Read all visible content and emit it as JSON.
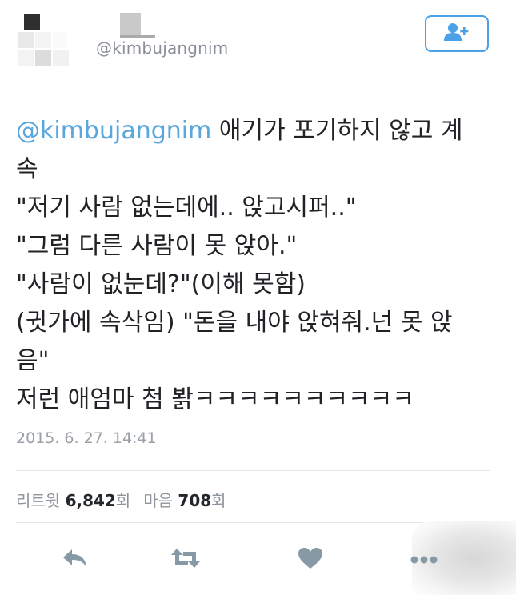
{
  "user": {
    "handle": "@kimbujangnim"
  },
  "follow_button": {
    "icon": "add-user-icon",
    "color": "#4aa1e8"
  },
  "tweet": {
    "lines": [
      {
        "mention": "@kimbujangnim",
        "text": " 애기가 포기하지 않고 계"
      },
      {
        "text": "속"
      },
      {
        "text": "\"저기 사람 없는데에.. 앉고시퍼..\""
      },
      {
        "text": "\"그럼 다른 사람이 못 앉아.\""
      },
      {
        "text": "\"사람이 없눈데?\"(이해 못함)"
      },
      {
        "text": "(귓가에 속삭임) \"돈을 내야 앉혀줘.넌 못 앉"
      },
      {
        "text": "음\""
      },
      {
        "text": "저런 애엄마 첨 봙ㅋㅋㅋㅋㅋㅋㅋㅋㅋㅋ"
      }
    ]
  },
  "timestamp": "2015. 6. 27. 14:41",
  "stats": {
    "retweets_label": "리트윗",
    "retweets_count": "6,842",
    "retweets_unit": "회",
    "likes_label": "마음",
    "likes_count": "708",
    "likes_unit": "회"
  },
  "actions": [
    {
      "name": "reply",
      "icon": "reply-icon"
    },
    {
      "name": "retweet",
      "icon": "retweet-icon"
    },
    {
      "name": "like",
      "icon": "heart-icon"
    },
    {
      "name": "more",
      "icon": "more-icon"
    }
  ],
  "colors": {
    "mention": "#5aa7dd",
    "icon_gray": "#8899a6",
    "text": "#202226"
  }
}
